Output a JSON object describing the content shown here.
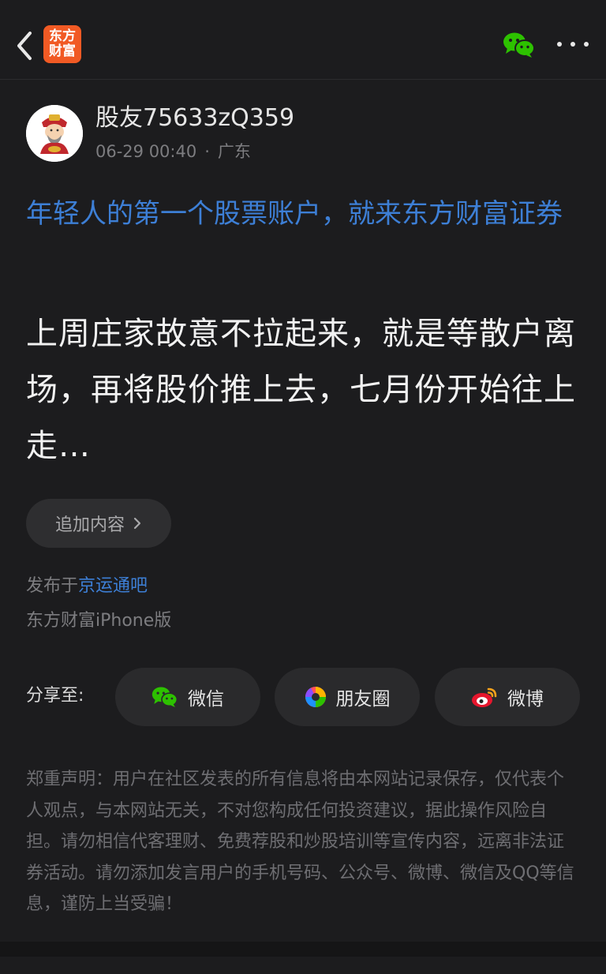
{
  "topbar": {
    "logo_line1": "东方",
    "logo_line2": "财富",
    "icons": [
      "back-chevron-icon",
      "wechat-icon",
      "more-dots-icon"
    ]
  },
  "author": {
    "name": "股友75633zQ359",
    "date": "06-29 00:40",
    "separator": "·",
    "location": "广东"
  },
  "ad": {
    "text": "年轻人的第一个股票账户，就来东方财富证券"
  },
  "post": {
    "body": "上周庄家故意不拉起来，就是等散户离场，再将股价推上去，七月份开始往上走…"
  },
  "append": {
    "label": "追加内容",
    "chevron": "›"
  },
  "meta": {
    "posted_prefix": "发布于",
    "forum": "京运通吧",
    "client": "东方财富iPhone版"
  },
  "share": {
    "label": "分享至:",
    "targets": [
      {
        "label": "微信",
        "icon": "wechat-icon"
      },
      {
        "label": "朋友圈",
        "icon": "moments-icon"
      },
      {
        "label": "微博",
        "icon": "weibo-icon"
      }
    ]
  },
  "disclaimer": {
    "text": "郑重声明：用户在社区发表的所有信息将由本网站记录保存，仅代表个人观点，与本网站无关，不对您构成任何投资建议，据此操作风险自担。请勿相信代客理财、免费荐股和炒股培训等宣传内容，远离非法证券活动。请勿添加发言用户的手机号码、公众号、微博、微信及QQ等信息，谨防上当受骗！"
  },
  "colors": {
    "background": "#1c1c1e",
    "accent_link": "#3d7fd6",
    "logo_orange": "#f15a24",
    "wechat_green": "#2dc100",
    "weibo_red": "#e6162d"
  }
}
